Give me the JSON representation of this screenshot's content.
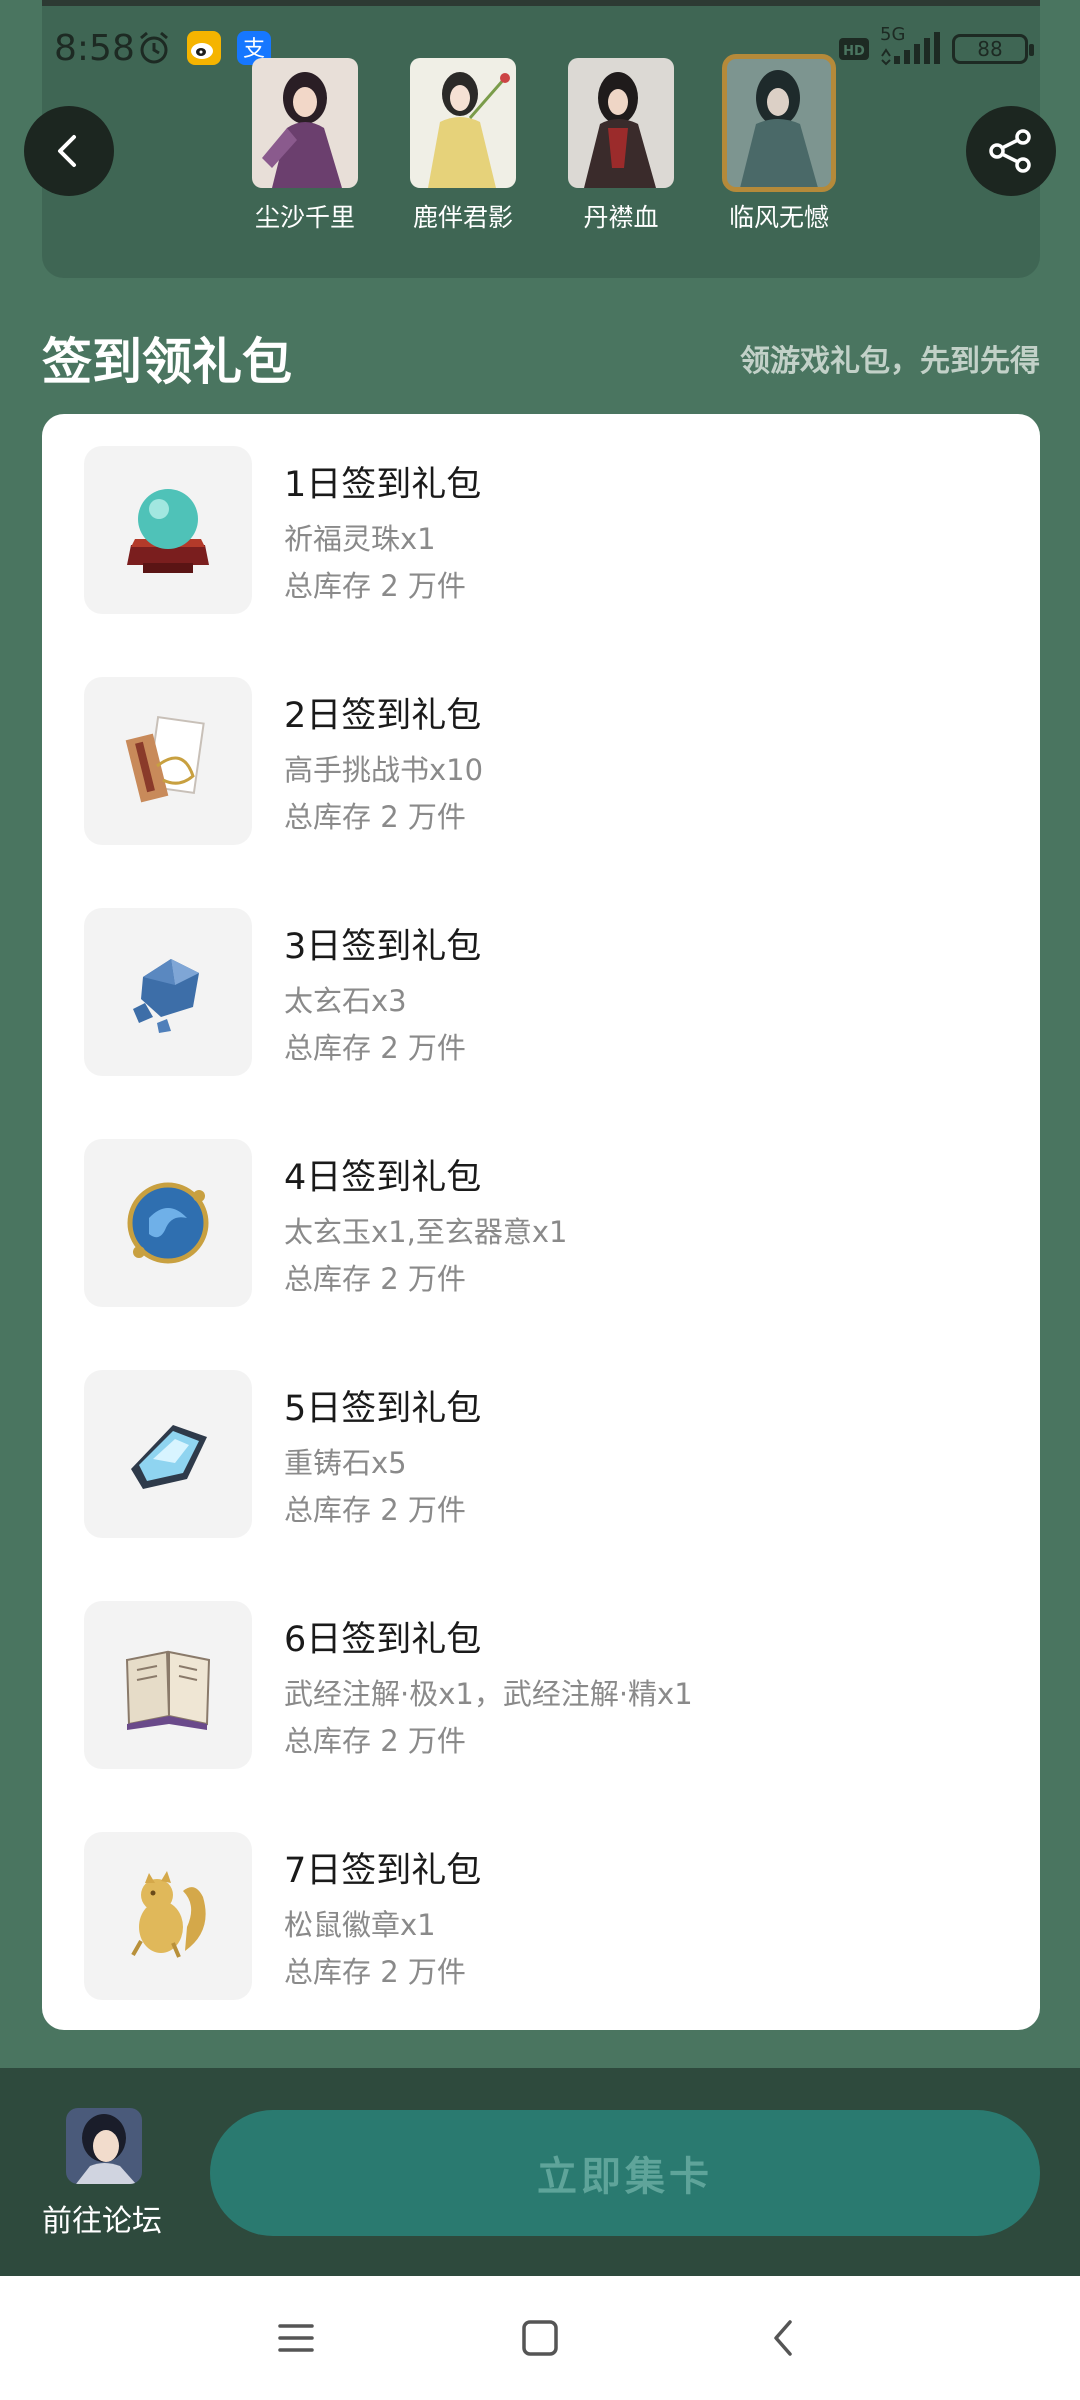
{
  "status": {
    "time": "8:58",
    "network": "5G",
    "battery": "88"
  },
  "characters": [
    {
      "name": "尘沙千里",
      "selected": false
    },
    {
      "name": "鹿伴君影",
      "selected": false
    },
    {
      "name": "丹襟血",
      "selected": false
    },
    {
      "name": "临风无憾",
      "selected": true
    }
  ],
  "section": {
    "title": "签到领礼包",
    "subtitle": "领游戏礼包，先到先得"
  },
  "gifts": [
    {
      "title": "1日签到礼包",
      "items": "祈福灵珠x1",
      "stock": "总库存 2 万件",
      "icon": "crystal-orb-icon"
    },
    {
      "title": "2日签到礼包",
      "items": "高手挑战书x10",
      "stock": "总库存 2 万件",
      "icon": "challenge-scroll-icon"
    },
    {
      "title": "3日签到礼包",
      "items": "太玄石x3",
      "stock": "总库存 2 万件",
      "icon": "blue-stone-icon"
    },
    {
      "title": "4日签到礼包",
      "items": "太玄玉x1,至玄器意x1",
      "stock": "总库存 2 万件",
      "icon": "jade-orb-icon"
    },
    {
      "title": "5日签到礼包",
      "items": "重铸石x5",
      "stock": "总库存 2 万件",
      "icon": "reforge-stone-icon"
    },
    {
      "title": "6日签到礼包",
      "items": "武经注解·极x1，武经注解·精x1",
      "stock": "总库存 2 万件",
      "icon": "book-icon"
    },
    {
      "title": "7日签到礼包",
      "items": "松鼠徽章x1",
      "stock": "总库存 2 万件",
      "icon": "squirrel-badge-icon"
    }
  ],
  "bottom": {
    "forum_label": "前往论坛",
    "collect_label": "立即集卡"
  },
  "colors": {
    "background": "#4a7560",
    "button": "#2a7a70",
    "bottom_bar": "#2e4a3d"
  }
}
